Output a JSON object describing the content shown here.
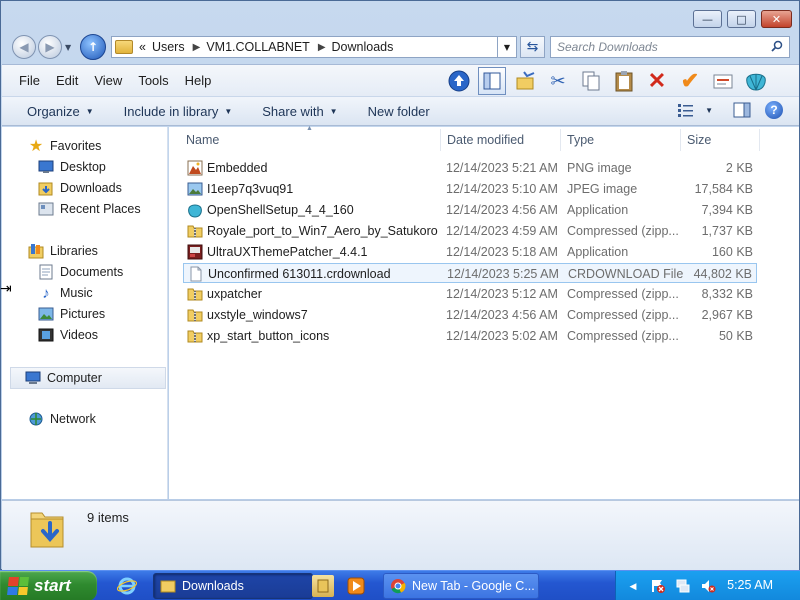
{
  "window": {
    "controls": {
      "minimize": "—",
      "maximize": "□",
      "close": "✕"
    }
  },
  "address": {
    "crumbs": [
      "Users",
      "VM1.COLLABNET",
      "Downloads"
    ],
    "prefix": "«",
    "search_placeholder": "Search Downloads"
  },
  "menu": [
    "File",
    "Edit",
    "View",
    "Tools",
    "Help"
  ],
  "commandbar": {
    "organize": "Organize",
    "include": "Include in library",
    "share": "Share with",
    "new_folder": "New folder"
  },
  "navpane": {
    "favorites": "Favorites",
    "desktop": "Desktop",
    "downloads": "Downloads",
    "recent": "Recent Places",
    "libraries": "Libraries",
    "documents": "Documents",
    "music": "Music",
    "pictures": "Pictures",
    "videos": "Videos",
    "computer": "Computer",
    "network": "Network"
  },
  "columns": {
    "name": "Name",
    "date": "Date modified",
    "type": "Type",
    "size": "Size"
  },
  "files": [
    {
      "name": "Embedded",
      "date": "12/14/2023 5:21 AM",
      "type": "PNG image",
      "size": "2 KB",
      "icon": "png-icon"
    },
    {
      "name": "I1eep7q3vuq91",
      "date": "12/14/2023 5:10 AM",
      "type": "JPEG image",
      "size": "17,584 KB",
      "icon": "jpeg-icon"
    },
    {
      "name": "OpenShellSetup_4_4_160",
      "date": "12/14/2023 4:56 AM",
      "type": "Application",
      "size": "7,394 KB",
      "icon": "openshell-icon"
    },
    {
      "name": "Royale_port_to_Win7_Aero_by_Satukoro",
      "date": "12/14/2023 4:59 AM",
      "type": "Compressed (zipp...",
      "size": "1,737 KB",
      "icon": "zip-folder-icon"
    },
    {
      "name": "UltraUXThemePatcher_4.4.1",
      "date": "12/14/2023 5:18 AM",
      "type": "Application",
      "size": "160 KB",
      "icon": "patcher-app-icon"
    },
    {
      "name": "Unconfirmed 613011.crdownload",
      "date": "12/14/2023 5:25 AM",
      "type": "CRDOWNLOAD File",
      "size": "44,802 KB",
      "icon": "blank-file-icon",
      "selected": true
    },
    {
      "name": "uxpatcher",
      "date": "12/14/2023 5:12 AM",
      "type": "Compressed (zipp...",
      "size": "8,332 KB",
      "icon": "zip-folder-icon"
    },
    {
      "name": "uxstyle_windows7",
      "date": "12/14/2023 4:56 AM",
      "type": "Compressed (zipp...",
      "size": "2,967 KB",
      "icon": "zip-folder-icon"
    },
    {
      "name": "xp_start_button_icons",
      "date": "12/14/2023 5:02 AM",
      "type": "Compressed (zipp...",
      "size": "50 KB",
      "icon": "zip-folder-icon"
    }
  ],
  "details": {
    "count": "9 items"
  },
  "taskbar": {
    "start": "start",
    "tasks": [
      {
        "label": "Downloads",
        "active": true
      },
      {
        "label": "New Tab - Google C...",
        "active": false
      }
    ],
    "clock": "5:25 AM"
  }
}
